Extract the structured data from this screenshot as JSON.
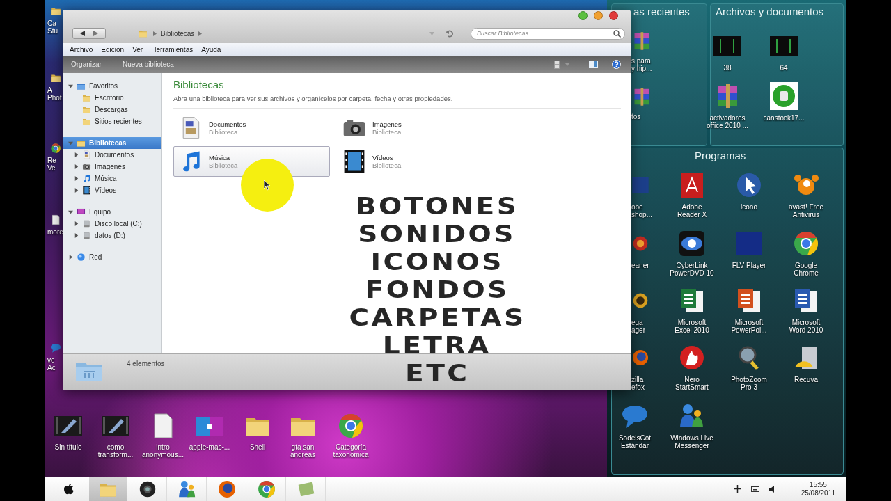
{
  "window": {
    "breadcrumb": "Bibliotecas",
    "search_placeholder": "Buscar Bibliotecas",
    "menu": [
      "Archivo",
      "Edición",
      "Ver",
      "Herramientas",
      "Ayuda"
    ],
    "commands": [
      "Organizar",
      "Nueva biblioteca"
    ],
    "nav": [
      {
        "label": "Favoritos",
        "kind": "favorites",
        "expanded": true,
        "selected": false,
        "children": [
          {
            "label": "Escritorio",
            "kind": "folder",
            "selected": false
          },
          {
            "label": "Descargas",
            "kind": "folder",
            "selected": false
          },
          {
            "label": "Sitios recientes",
            "kind": "folder",
            "selected": false
          }
        ]
      },
      {
        "label": "Bibliotecas",
        "kind": "folder",
        "expanded": true,
        "selected": true,
        "children": [
          {
            "label": "Documentos",
            "kind": "documents",
            "expanded": false,
            "selected": false
          },
          {
            "label": "Imágenes",
            "kind": "images",
            "expanded": false,
            "selected": false
          },
          {
            "label": "Música",
            "kind": "music",
            "expanded": false,
            "selected": false
          },
          {
            "label": "Vídeos",
            "kind": "videos",
            "expanded": false,
            "selected": false
          }
        ]
      },
      {
        "label": "Equipo",
        "kind": "monitor",
        "expanded": true,
        "selected": false,
        "children": [
          {
            "label": "Disco local (C:)",
            "kind": "drive",
            "expanded": false,
            "selected": false
          },
          {
            "label": "datos (D:)",
            "kind": "drive",
            "expanded": false,
            "selected": false
          }
        ]
      },
      {
        "label": "Red",
        "kind": "globe",
        "expanded": false,
        "selected": false
      }
    ],
    "heading": "Bibliotecas",
    "description": "Abra una biblioteca para ver sus archivos y organícelos por carpeta, fecha y otras propiedades.",
    "libraries": [
      {
        "kind": "documents",
        "name": "Documentos",
        "type": "Biblioteca",
        "selected": false
      },
      {
        "kind": "images",
        "name": "Imágenes",
        "type": "Biblioteca",
        "selected": false
      },
      {
        "kind": "music",
        "name": "Música",
        "type": "Biblioteca",
        "selected": true
      },
      {
        "kind": "videos",
        "name": "Vídeos",
        "type": "Biblioteca",
        "selected": false
      }
    ],
    "status": "4 elementos"
  },
  "caption": [
    "BOTONES",
    "SONIDOS",
    "ICONOS",
    "FONDOS",
    "CARPETAS",
    "LETRA",
    "ETC"
  ],
  "edge_icons": [
    {
      "kind": "folder",
      "lines": [
        "Ca",
        "Stu"
      ]
    },
    {
      "kind": "folder",
      "lines": [
        "A",
        "Phot"
      ]
    },
    {
      "kind": "chrome",
      "lines": [
        "Re",
        "Ve"
      ]
    },
    {
      "kind": "printer",
      "lines": [
        "more"
      ]
    },
    {
      "kind": "chat",
      "lines": [
        "ve",
        "Ac"
      ]
    }
  ],
  "desktop_icons": [
    {
      "kind": "video",
      "lines": [
        "Sin título"
      ]
    },
    {
      "kind": "video",
      "lines": [
        "como",
        "transform..."
      ]
    },
    {
      "kind": "printer",
      "lines": [
        "intro",
        "anonymous..."
      ]
    },
    {
      "kind": "wallpaper",
      "lines": [
        "apple-mac-..."
      ]
    },
    {
      "kind": "folder",
      "lines": [
        "Shell"
      ]
    },
    {
      "kind": "folder",
      "lines": [
        "gta san",
        "andreas"
      ]
    },
    {
      "kind": "chrome",
      "lines": [
        "Categoría",
        "taxonómica"
      ]
    }
  ],
  "gadgets": {
    "recent": {
      "title": "as recientes",
      "items": [
        {
          "kind": "archive",
          "cut": true,
          "lines": [
            "s para",
            "y hip..."
          ]
        },
        {
          "kind": "archive",
          "cut": true,
          "lines": [
            "tos"
          ]
        }
      ]
    },
    "files": {
      "title": "Archivos y documentos",
      "items": [
        {
          "kind": "darkthumb",
          "lines": [
            "38"
          ]
        },
        {
          "kind": "darkthumb",
          "lines": [
            "64"
          ]
        },
        {
          "kind": "archive",
          "lines": [
            "activadores",
            "office 2010 ..."
          ]
        },
        {
          "kind": "thumb",
          "lines": [
            "canstock17..."
          ]
        }
      ]
    },
    "programs": {
      "title": "Programas",
      "items": [
        {
          "kind": "ps",
          "cut": true,
          "lines": [
            "obe",
            "shop..."
          ]
        },
        {
          "kind": "pdf",
          "lines": [
            "Adobe",
            "Reader X"
          ]
        },
        {
          "kind": "cursor",
          "lines": [
            "icono"
          ]
        },
        {
          "kind": "avast",
          "lines": [
            "avast! Free",
            "Antivirus"
          ]
        },
        {
          "kind": "ccleaner",
          "cut": true,
          "lines": [
            "eaner"
          ]
        },
        {
          "kind": "dvd",
          "lines": [
            "CyberLink",
            "PowerDVD 10"
          ]
        },
        {
          "kind": "flv",
          "lines": [
            "FLV Player"
          ]
        },
        {
          "kind": "chrome",
          "lines": [
            "Google",
            "Chrome"
          ]
        },
        {
          "kind": "mega",
          "cut": true,
          "lines": [
            "ega",
            "ager"
          ]
        },
        {
          "kind": "excel",
          "lines": [
            "Microsoft",
            "Excel 2010"
          ]
        },
        {
          "kind": "ppt",
          "lines": [
            "Microsoft",
            "PowerPoi..."
          ]
        },
        {
          "kind": "word",
          "lines": [
            "Microsoft",
            "Word 2010"
          ]
        },
        {
          "kind": "firefox",
          "cut": true,
          "lines": [
            "zilla",
            "efox"
          ]
        },
        {
          "kind": "nero",
          "lines": [
            "Nero",
            "StartSmart"
          ]
        },
        {
          "kind": "zoom",
          "lines": [
            "PhotoZoom",
            "Pro 3"
          ]
        },
        {
          "kind": "recuva",
          "lines": [
            "Recuva"
          ]
        },
        {
          "kind": "chat",
          "lines": [
            "SodelsCot",
            "Estándar"
          ]
        },
        {
          "kind": "messenger",
          "lines": [
            "Windows Live",
            "Messenger"
          ]
        }
      ]
    }
  },
  "taskbar": {
    "items": [
      {
        "kind": "folder",
        "selected": true
      },
      {
        "kind": "webcam",
        "selected": false
      },
      {
        "kind": "messenger",
        "selected": false
      },
      {
        "kind": "firefox",
        "selected": false
      },
      {
        "kind": "chrome",
        "selected": false
      },
      {
        "kind": "notes",
        "selected": false
      }
    ],
    "time": "15:55",
    "date": "25/08/2011"
  }
}
